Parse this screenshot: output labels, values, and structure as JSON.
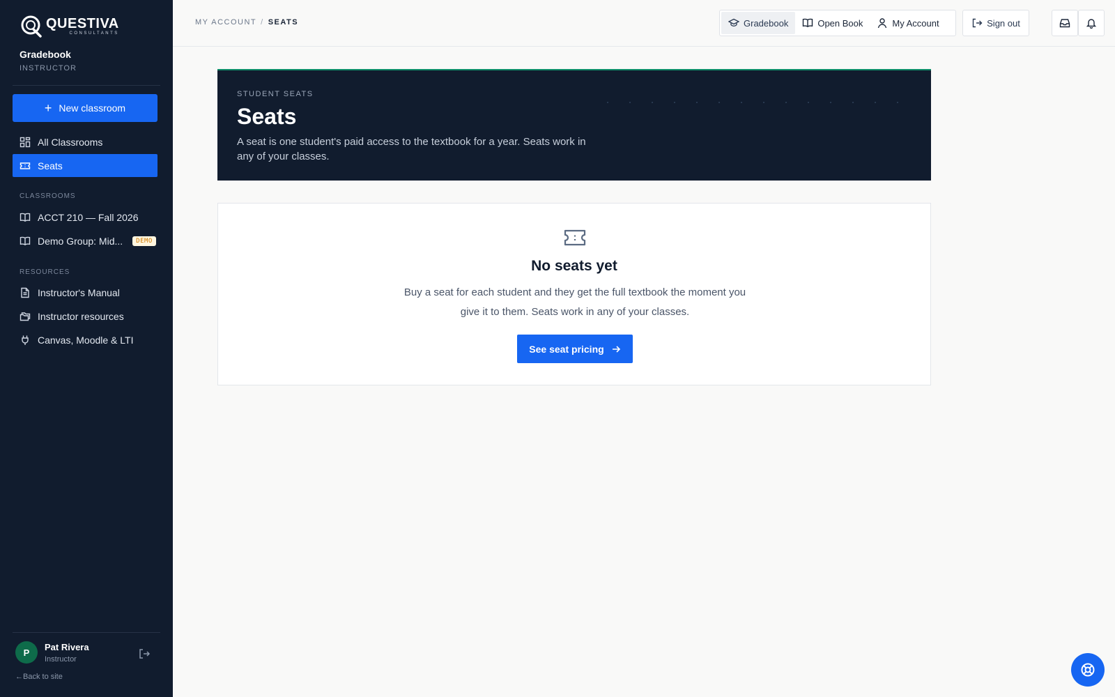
{
  "brand": {
    "name": "QUESTIVA",
    "sub": "CONSULTANTS"
  },
  "app": {
    "name": "Gradebook",
    "role": "INSTRUCTOR"
  },
  "sidebar": {
    "new_button": "New classroom",
    "nav": [
      {
        "label": "All Classrooms",
        "icon": "grid-icon"
      },
      {
        "label": "Seats",
        "icon": "ticket-icon",
        "active": true
      }
    ],
    "classrooms_label": "CLASSROOMS",
    "classrooms": [
      {
        "label": "ACCT 210 — Fall 2026",
        "icon": "book-icon"
      },
      {
        "label": "Demo Group: Mid...",
        "icon": "book-icon",
        "badge": "DEMO"
      }
    ],
    "resources_label": "RESOURCES",
    "resources": [
      {
        "label": "Instructor's Manual",
        "icon": "document-icon"
      },
      {
        "label": "Instructor resources",
        "icon": "folders-icon"
      },
      {
        "label": "Canvas, Moodle & LTI",
        "icon": "plug-icon"
      }
    ]
  },
  "user": {
    "initial": "P",
    "name": "Pat Rivera",
    "role": "Instructor",
    "back_link": "←Back to site"
  },
  "breadcrumb": {
    "parent": "MY ACCOUNT",
    "separator": "/",
    "current": "SEATS"
  },
  "topnav": {
    "gradebook": "Gradebook",
    "open_book": "Open Book",
    "my_account": "My Account",
    "sign_out": "Sign out"
  },
  "hero": {
    "kicker": "STUDENT SEATS",
    "title": "Seats",
    "description": "A seat is one student's paid access to the textbook for a year. Seats work in any of your classes."
  },
  "empty_state": {
    "title": "No seats yet",
    "description": "Buy a seat for each student and they get the full textbook the moment you give it to them. Seats work in any of your classes.",
    "button": "See seat pricing"
  },
  "colors": {
    "sidebar": "#111c2e",
    "accent": "#1766f2",
    "hero_border": "#0f8f6a",
    "avatar": "#0e6b4a"
  }
}
